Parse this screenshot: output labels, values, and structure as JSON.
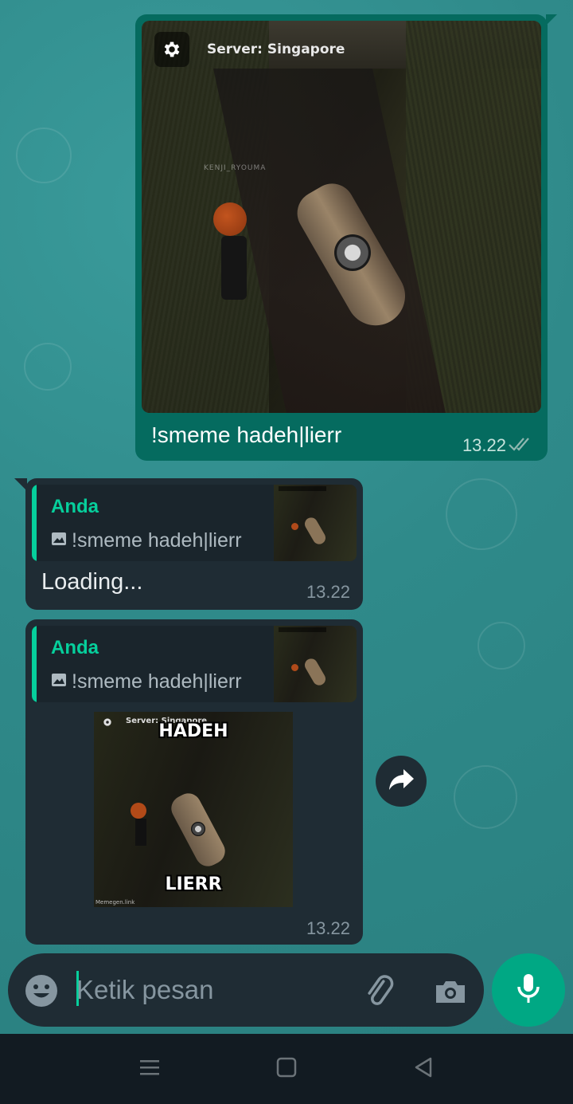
{
  "chat": {
    "outgoing_image_message": {
      "image_overlay": {
        "server_label": "Server: Singapore",
        "player_name": "KENJI_RYOUMA"
      },
      "caption": "!smeme hadeh|lierr",
      "time": "13.22",
      "status_icon": "double-check-icon"
    },
    "reply_loading_message": {
      "quoted_sender": "Anda",
      "quoted_icon": "image-icon",
      "quoted_text": "!smeme hadeh|lierr",
      "text": "Loading...",
      "time": "13.22"
    },
    "reply_sticker_message": {
      "quoted_sender": "Anda",
      "quoted_icon": "image-icon",
      "quoted_text": "!smeme hadeh|lierr",
      "sticker_server_label": "Server: Singapore",
      "sticker_top_text": "HADEH",
      "sticker_bottom_text": "LIERR",
      "sticker_watermark": "Memegen.link",
      "time": "13.22"
    },
    "forward_icon": "share-forward-icon"
  },
  "composer": {
    "placeholder": "Ketik pesan",
    "emoji_icon": "emoji-icon",
    "attach_icon": "paperclip-icon",
    "camera_icon": "camera-icon",
    "mic_icon": "microphone-icon"
  },
  "navigation": {
    "buttons": [
      "menu-icon",
      "home-square-icon",
      "back-triangle-icon"
    ]
  },
  "colors": {
    "wallpaper": "#2e8c8c",
    "outgoing_bubble": "#056b5f",
    "incoming_bubble": "#1f2c34",
    "accent": "#06cf9c",
    "mic_button": "#00a884",
    "nav_bar": "#121b22"
  }
}
